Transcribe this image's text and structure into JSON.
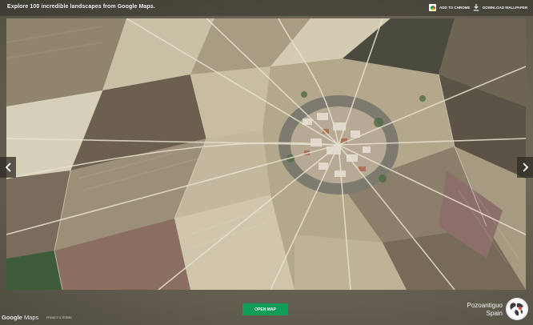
{
  "header": {
    "tagline": "Explore 100 incredible landscapes from Google Maps.",
    "add_to_chrome": "ADD TO CHROME",
    "download_wallpaper": "DOWNLOAD WALLPAPER"
  },
  "navigation": {
    "prev_icon": "chevron-left-icon",
    "next_icon": "chevron-right-icon"
  },
  "footer": {
    "open_map_label": "OPEN MAP",
    "logo_google": "Google",
    "logo_maps": "Maps",
    "privacy_terms": "PRIVACY & TERMS",
    "location_region": "Pozoantiguo",
    "location_country": "Spain"
  },
  "colors": {
    "accent_green": "#0f9d58",
    "chrome_red": "#db4437",
    "chrome_yellow": "#f4b400"
  }
}
